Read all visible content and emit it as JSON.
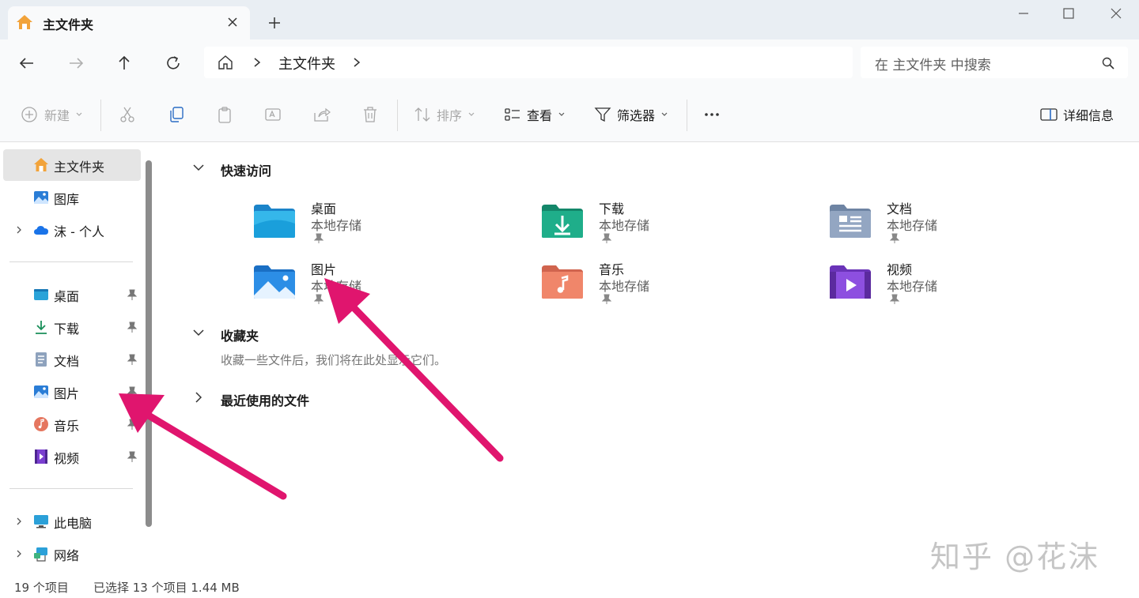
{
  "window": {
    "tab_title": "主文件夹",
    "new_tab": "+"
  },
  "address": {
    "current": "主文件夹",
    "search_placeholder": "在 主文件夹 中搜索"
  },
  "toolbar": {
    "new_label": "新建",
    "sort_label": "排序",
    "view_label": "查看",
    "filter_label": "筛选器",
    "details_label": "详细信息"
  },
  "sidebar": {
    "top_items": [
      {
        "label": "主文件夹",
        "icon": "home-icon"
      },
      {
        "label": "图库",
        "icon": "gallery-icon"
      },
      {
        "label": "沫 - 个人",
        "icon": "onedrive-icon"
      }
    ],
    "pinned_items": [
      {
        "label": "桌面",
        "icon": "desktop-icon"
      },
      {
        "label": "下载",
        "icon": "download-icon"
      },
      {
        "label": "文档",
        "icon": "documents-icon"
      },
      {
        "label": "图片",
        "icon": "pictures-icon"
      },
      {
        "label": "音乐",
        "icon": "music-icon"
      },
      {
        "label": "视频",
        "icon": "videos-icon"
      }
    ],
    "bottom_items": [
      {
        "label": "此电脑",
        "icon": "this-pc-icon"
      },
      {
        "label": "网络",
        "icon": "network-icon"
      }
    ]
  },
  "main": {
    "quick_access_title": "快速访问",
    "favorites_title": "收藏夹",
    "favorites_empty": "收藏一些文件后，我们将在此处显示它们。",
    "recent_title": "最近使用的文件",
    "quick_access": [
      {
        "name": "桌面",
        "location": "本地存储",
        "icon": "desktop-folder-icon"
      },
      {
        "name": "下载",
        "location": "本地存储",
        "icon": "downloads-folder-icon"
      },
      {
        "name": "文档",
        "location": "本地存储",
        "icon": "documents-folder-icon"
      },
      {
        "name": "图片",
        "location": "本地存储",
        "icon": "pictures-folder-icon"
      },
      {
        "name": "音乐",
        "location": "本地存储",
        "icon": "music-folder-icon"
      },
      {
        "name": "视频",
        "location": "本地存储",
        "icon": "videos-folder-icon"
      }
    ]
  },
  "status": {
    "item_count": "19 个项目",
    "selection": "已选择 13 个项目  1.44 MB"
  },
  "watermark": "知乎 @花沫",
  "colors": {
    "titlebar": "#e9eef3",
    "arrow": "#e0156e",
    "accent": "#0067c0"
  }
}
